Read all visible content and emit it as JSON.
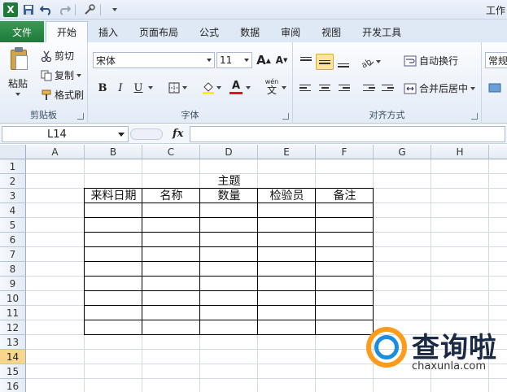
{
  "app": {
    "window_title": "工作",
    "tabs": [
      "文件",
      "开始",
      "插入",
      "页面布局",
      "公式",
      "数据",
      "审阅",
      "视图",
      "开发工具"
    ],
    "active_tab": "开始"
  },
  "ribbon": {
    "clipboard": {
      "label": "剪贴板",
      "paste": "粘贴",
      "cut": "剪切",
      "copy": "复制",
      "format_painter": "格式刷"
    },
    "font": {
      "label": "字体",
      "font_name": "宋体",
      "font_size": "11",
      "bold": "B",
      "italic": "I",
      "underline": "U",
      "grow": "A",
      "shrink": "A",
      "font_color_letter": "A",
      "phonetic": "wén"
    },
    "alignment": {
      "label": "对齐方式",
      "wrap_text": "自动换行",
      "merge_center": "合并后居中"
    },
    "number": {
      "format": "常规"
    }
  },
  "formula_bar": {
    "name_box": "L14",
    "fx": "fx",
    "content": ""
  },
  "sheet": {
    "columns": [
      "A",
      "B",
      "C",
      "D",
      "E",
      "F",
      "G",
      "H"
    ],
    "rows": [
      "1",
      "2",
      "3",
      "4",
      "5",
      "6",
      "7",
      "8",
      "9",
      "10",
      "11",
      "12",
      "13",
      "14",
      "15",
      "16"
    ],
    "selected_row": "14",
    "title_cell": "主题",
    "table_headers": [
      "来料日期",
      "名称",
      "数量",
      "检验员",
      "备注"
    ]
  },
  "watermark": {
    "brand": "查询啦",
    "url": "chaxunla.com"
  },
  "colors": {
    "file_tab": "#1e7a3a",
    "selected_row_header": "#f8d68a",
    "watermark_orange": "#ff9b1a",
    "watermark_blue": "#1a8de0"
  }
}
